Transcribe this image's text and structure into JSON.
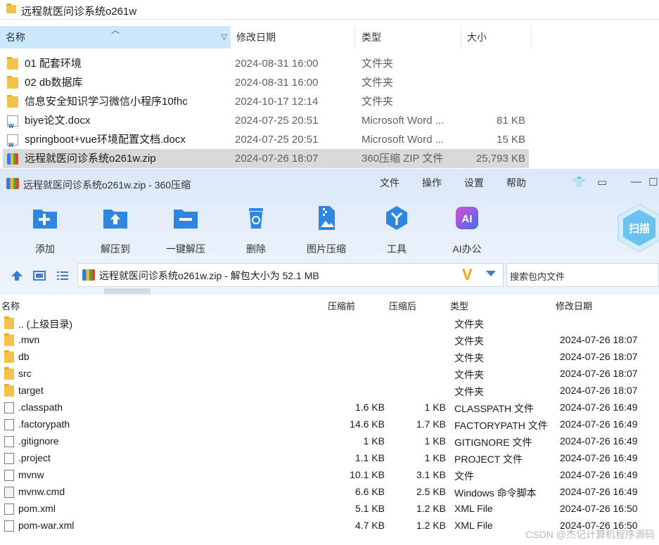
{
  "explorer": {
    "title": "远程就医问诊系统o261w",
    "columns": {
      "name": "名称",
      "date": "修改日期",
      "type": "类型",
      "size": "大小"
    },
    "rows": [
      {
        "name": "01 配套环境",
        "date": "2024-08-31 16:00",
        "type": "文件夹",
        "size": "",
        "icon": "folder-icon"
      },
      {
        "name": "02 db数据库",
        "date": "2024-08-31 16:00",
        "type": "文件夹",
        "size": "",
        "icon": "folder-icon"
      },
      {
        "name": "信息安全知识学习微信小程序10fhc",
        "date": "2024-10-17 12:14",
        "type": "文件夹",
        "size": "",
        "icon": "folder-icon"
      },
      {
        "name": "biye论文.docx",
        "date": "2024-07-25 20:51",
        "type": "Microsoft Word ...",
        "size": "81 KB",
        "icon": "word-doc-icon"
      },
      {
        "name": "springboot+vue环境配置文档.docx",
        "date": "2024-07-25 20:51",
        "type": "Microsoft Word ...",
        "size": "15 KB",
        "icon": "word-doc-icon"
      },
      {
        "name": "远程就医问诊系统o261w.zip",
        "date": "2024-07-26 18:07",
        "type": "360压缩 ZIP 文件",
        "size": "25,793 KB",
        "icon": "zip-icon"
      }
    ]
  },
  "zip": {
    "title": "远程就医问诊系统o261w.zip - 360压缩",
    "menu": [
      "文件",
      "操作",
      "设置",
      "帮助"
    ],
    "toolbar": [
      "添加",
      "解压到",
      "一键解压",
      "删除",
      "图片压缩",
      "工具",
      "AI办公"
    ],
    "scan_label": "扫描",
    "ai_badge": "AI",
    "path_text": "远程就医问诊系统o261w.zip - 解包大小为 52.1 MB",
    "search_placeholder": "搜索包内文件",
    "columns": {
      "name": "名称",
      "compressed": "压缩前",
      "uncompressed": "压缩后",
      "type": "类型",
      "date": "修改日期"
    },
    "rows": [
      {
        "name": ".. (上级目录)",
        "cs": "",
        "us": "",
        "type": "文件夹",
        "date": "",
        "icon": "folder"
      },
      {
        "name": ".mvn",
        "cs": "",
        "us": "",
        "type": "文件夹",
        "date": "2024-07-26 18:07",
        "icon": "folder"
      },
      {
        "name": "db",
        "cs": "",
        "us": "",
        "type": "文件夹",
        "date": "2024-07-26 18:07",
        "icon": "folder"
      },
      {
        "name": "src",
        "cs": "",
        "us": "",
        "type": "文件夹",
        "date": "2024-07-26 18:07",
        "icon": "folder"
      },
      {
        "name": "target",
        "cs": "",
        "us": "",
        "type": "文件夹",
        "date": "2024-07-26 18:07",
        "icon": "folder"
      },
      {
        "name": ".classpath",
        "cs": "1.6 KB",
        "us": "1 KB",
        "type": "CLASSPATH 文件",
        "date": "2024-07-26 16:49",
        "icon": "file"
      },
      {
        "name": ".factorypath",
        "cs": "14.6 KB",
        "us": "1.7 KB",
        "type": "FACTORYPATH 文件",
        "date": "2024-07-26 16:49",
        "icon": "file"
      },
      {
        "name": ".gitignore",
        "cs": "1 KB",
        "us": "1 KB",
        "type": "GITIGNORE 文件",
        "date": "2024-07-26 16:49",
        "icon": "file"
      },
      {
        "name": ".project",
        "cs": "1.1 KB",
        "us": "1 KB",
        "type": "PROJECT 文件",
        "date": "2024-07-26 16:49",
        "icon": "file"
      },
      {
        "name": "mvnw",
        "cs": "10.1 KB",
        "us": "3.1 KB",
        "type": "文件",
        "date": "2024-07-26 16:49",
        "icon": "file"
      },
      {
        "name": "mvnw.cmd",
        "cs": "6.6 KB",
        "us": "2.5 KB",
        "type": "Windows 命令脚本",
        "date": "2024-07-26 16:49",
        "icon": "cmd"
      },
      {
        "name": "pom.xml",
        "cs": "5.1 KB",
        "us": "1.2 KB",
        "type": "XML File",
        "date": "2024-07-26 16:50",
        "icon": "file"
      },
      {
        "name": "pom-war.xml",
        "cs": "4.7 KB",
        "us": "1.2 KB",
        "type": "XML File",
        "date": "2024-07-26 16:50",
        "icon": "file"
      }
    ]
  },
  "watermark": "CSDN @杰记计算机程序源码"
}
